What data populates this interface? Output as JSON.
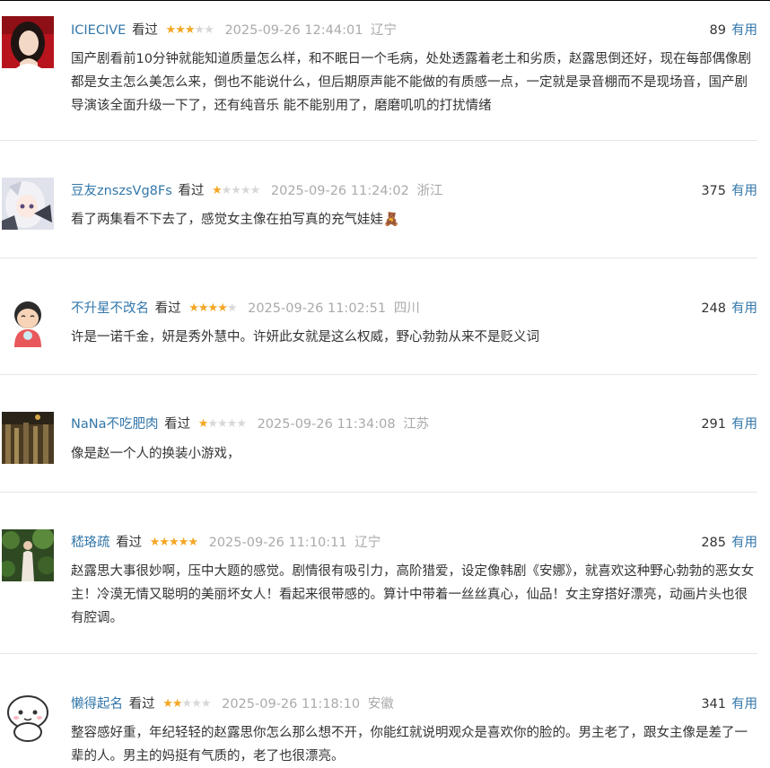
{
  "colors": {
    "link": "#3377aa",
    "star_on": "#f5a623",
    "star_off": "#d8d8d8",
    "muted": "#aaaaaa",
    "divider": "#e6e6e6"
  },
  "comments": [
    {
      "user": "ICIECIVE",
      "status": "看过",
      "rating": 3,
      "rating_max": 5,
      "time": "2025-09-26 12:44:01",
      "location": "辽宁",
      "votes": "89",
      "useful_label": "有用",
      "text": "国产剧看前10分钟就能知道质量怎么样，和不眠日一个毛病，处处透露着老土和劣质，赵露思倒还好，现在每部偶像剧都是女主怎么美怎么来，倒也不能说什么，但后期原声能不能做的有质感一点，一定就是录音棚而不是现场音，国产剧导演该全面升级一下了，还有纯音乐 能不能别用了，磨磨叽叽的打扰情绪"
    },
    {
      "user": "豆友znszsVg8Fs",
      "status": "看过",
      "rating": 1,
      "rating_max": 5,
      "time": "2025-09-26 11:24:02",
      "location": "浙江",
      "votes": "375",
      "useful_label": "有用",
      "text": "看了两集看不下去了，感觉女主像在拍写真的充气娃娃🧸"
    },
    {
      "user": "不升星不改名",
      "status": "看过",
      "rating": 4,
      "rating_max": 5,
      "time": "2025-09-26 11:02:51",
      "location": "四川",
      "votes": "248",
      "useful_label": "有用",
      "text": "许是一诺千金，妍是秀外慧中。许妍此女就是这么权威，野心勃勃从来不是贬义词"
    },
    {
      "user": "NaNa不吃肥肉",
      "status": "看过",
      "rating": 1,
      "rating_max": 5,
      "time": "2025-09-26 11:34:08",
      "location": "江苏",
      "votes": "291",
      "useful_label": "有用",
      "text": "像是赵一个人的换装小游戏，"
    },
    {
      "user": "嵇珞疏",
      "status": "看过",
      "rating": 5,
      "rating_max": 5,
      "time": "2025-09-26 11:10:11",
      "location": "辽宁",
      "votes": "285",
      "useful_label": "有用",
      "text": "赵露思大事很妙啊，压中大题的感觉。剧情很有吸引力，高阶猎爱，设定像韩剧《安娜》，就喜欢这种野心勃勃的恶女女主！冷漠无情又聪明的美丽坏女人！看起来很带感的。算计中带着一丝丝真心，仙品！女主穿搭好漂亮，动画片头也很有腔调。"
    },
    {
      "user": "懒得起名",
      "status": "看过",
      "rating": 2,
      "rating_max": 5,
      "time": "2025-09-26 11:18:10",
      "location": "安徽",
      "votes": "341",
      "useful_label": "有用",
      "text": "整容感好重，年纪轻轻的赵露思你怎么那么想不开，你能红就说明观众是喜欢你的脸的。男主老了，跟女主像是差了一辈的人。男主的妈挺有气质的，老了也很漂亮。"
    }
  ]
}
